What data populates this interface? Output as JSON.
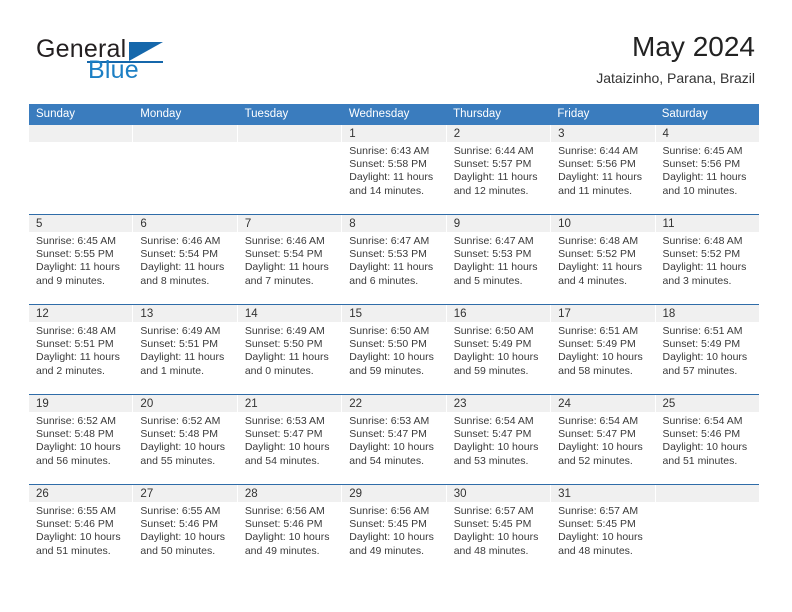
{
  "brand": {
    "name_part1": "General",
    "name_part2": "Blue",
    "flag_icon": "triangle-flag-icon"
  },
  "header": {
    "month_title": "May 2024",
    "location": "Jataizinho, Parana, Brazil"
  },
  "colors": {
    "header_band": "#3a7cbe",
    "row_divider": "#2f6ca8",
    "daynum_band": "#f0f0f0",
    "brand_blue": "#1c7fc4"
  },
  "weekdays": [
    "Sunday",
    "Monday",
    "Tuesday",
    "Wednesday",
    "Thursday",
    "Friday",
    "Saturday"
  ],
  "weeks": [
    [
      {
        "day": "",
        "empty": true
      },
      {
        "day": "",
        "empty": true
      },
      {
        "day": "",
        "empty": true
      },
      {
        "day": "1",
        "sunrise": "Sunrise: 6:43 AM",
        "sunset": "Sunset: 5:58 PM",
        "daylight1": "Daylight: 11 hours",
        "daylight2": "and 14 minutes."
      },
      {
        "day": "2",
        "sunrise": "Sunrise: 6:44 AM",
        "sunset": "Sunset: 5:57 PM",
        "daylight1": "Daylight: 11 hours",
        "daylight2": "and 12 minutes."
      },
      {
        "day": "3",
        "sunrise": "Sunrise: 6:44 AM",
        "sunset": "Sunset: 5:56 PM",
        "daylight1": "Daylight: 11 hours",
        "daylight2": "and 11 minutes."
      },
      {
        "day": "4",
        "sunrise": "Sunrise: 6:45 AM",
        "sunset": "Sunset: 5:56 PM",
        "daylight1": "Daylight: 11 hours",
        "daylight2": "and 10 minutes."
      }
    ],
    [
      {
        "day": "5",
        "sunrise": "Sunrise: 6:45 AM",
        "sunset": "Sunset: 5:55 PM",
        "daylight1": "Daylight: 11 hours",
        "daylight2": "and 9 minutes."
      },
      {
        "day": "6",
        "sunrise": "Sunrise: 6:46 AM",
        "sunset": "Sunset: 5:54 PM",
        "daylight1": "Daylight: 11 hours",
        "daylight2": "and 8 minutes."
      },
      {
        "day": "7",
        "sunrise": "Sunrise: 6:46 AM",
        "sunset": "Sunset: 5:54 PM",
        "daylight1": "Daylight: 11 hours",
        "daylight2": "and 7 minutes."
      },
      {
        "day": "8",
        "sunrise": "Sunrise: 6:47 AM",
        "sunset": "Sunset: 5:53 PM",
        "daylight1": "Daylight: 11 hours",
        "daylight2": "and 6 minutes."
      },
      {
        "day": "9",
        "sunrise": "Sunrise: 6:47 AM",
        "sunset": "Sunset: 5:53 PM",
        "daylight1": "Daylight: 11 hours",
        "daylight2": "and 5 minutes."
      },
      {
        "day": "10",
        "sunrise": "Sunrise: 6:48 AM",
        "sunset": "Sunset: 5:52 PM",
        "daylight1": "Daylight: 11 hours",
        "daylight2": "and 4 minutes."
      },
      {
        "day": "11",
        "sunrise": "Sunrise: 6:48 AM",
        "sunset": "Sunset: 5:52 PM",
        "daylight1": "Daylight: 11 hours",
        "daylight2": "and 3 minutes."
      }
    ],
    [
      {
        "day": "12",
        "sunrise": "Sunrise: 6:48 AM",
        "sunset": "Sunset: 5:51 PM",
        "daylight1": "Daylight: 11 hours",
        "daylight2": "and 2 minutes."
      },
      {
        "day": "13",
        "sunrise": "Sunrise: 6:49 AM",
        "sunset": "Sunset: 5:51 PM",
        "daylight1": "Daylight: 11 hours",
        "daylight2": "and 1 minute."
      },
      {
        "day": "14",
        "sunrise": "Sunrise: 6:49 AM",
        "sunset": "Sunset: 5:50 PM",
        "daylight1": "Daylight: 11 hours",
        "daylight2": "and 0 minutes."
      },
      {
        "day": "15",
        "sunrise": "Sunrise: 6:50 AM",
        "sunset": "Sunset: 5:50 PM",
        "daylight1": "Daylight: 10 hours",
        "daylight2": "and 59 minutes."
      },
      {
        "day": "16",
        "sunrise": "Sunrise: 6:50 AM",
        "sunset": "Sunset: 5:49 PM",
        "daylight1": "Daylight: 10 hours",
        "daylight2": "and 59 minutes."
      },
      {
        "day": "17",
        "sunrise": "Sunrise: 6:51 AM",
        "sunset": "Sunset: 5:49 PM",
        "daylight1": "Daylight: 10 hours",
        "daylight2": "and 58 minutes."
      },
      {
        "day": "18",
        "sunrise": "Sunrise: 6:51 AM",
        "sunset": "Sunset: 5:49 PM",
        "daylight1": "Daylight: 10 hours",
        "daylight2": "and 57 minutes."
      }
    ],
    [
      {
        "day": "19",
        "sunrise": "Sunrise: 6:52 AM",
        "sunset": "Sunset: 5:48 PM",
        "daylight1": "Daylight: 10 hours",
        "daylight2": "and 56 minutes."
      },
      {
        "day": "20",
        "sunrise": "Sunrise: 6:52 AM",
        "sunset": "Sunset: 5:48 PM",
        "daylight1": "Daylight: 10 hours",
        "daylight2": "and 55 minutes."
      },
      {
        "day": "21",
        "sunrise": "Sunrise: 6:53 AM",
        "sunset": "Sunset: 5:47 PM",
        "daylight1": "Daylight: 10 hours",
        "daylight2": "and 54 minutes."
      },
      {
        "day": "22",
        "sunrise": "Sunrise: 6:53 AM",
        "sunset": "Sunset: 5:47 PM",
        "daylight1": "Daylight: 10 hours",
        "daylight2": "and 54 minutes."
      },
      {
        "day": "23",
        "sunrise": "Sunrise: 6:54 AM",
        "sunset": "Sunset: 5:47 PM",
        "daylight1": "Daylight: 10 hours",
        "daylight2": "and 53 minutes."
      },
      {
        "day": "24",
        "sunrise": "Sunrise: 6:54 AM",
        "sunset": "Sunset: 5:47 PM",
        "daylight1": "Daylight: 10 hours",
        "daylight2": "and 52 minutes."
      },
      {
        "day": "25",
        "sunrise": "Sunrise: 6:54 AM",
        "sunset": "Sunset: 5:46 PM",
        "daylight1": "Daylight: 10 hours",
        "daylight2": "and 51 minutes."
      }
    ],
    [
      {
        "day": "26",
        "sunrise": "Sunrise: 6:55 AM",
        "sunset": "Sunset: 5:46 PM",
        "daylight1": "Daylight: 10 hours",
        "daylight2": "and 51 minutes."
      },
      {
        "day": "27",
        "sunrise": "Sunrise: 6:55 AM",
        "sunset": "Sunset: 5:46 PM",
        "daylight1": "Daylight: 10 hours",
        "daylight2": "and 50 minutes."
      },
      {
        "day": "28",
        "sunrise": "Sunrise: 6:56 AM",
        "sunset": "Sunset: 5:46 PM",
        "daylight1": "Daylight: 10 hours",
        "daylight2": "and 49 minutes."
      },
      {
        "day": "29",
        "sunrise": "Sunrise: 6:56 AM",
        "sunset": "Sunset: 5:45 PM",
        "daylight1": "Daylight: 10 hours",
        "daylight2": "and 49 minutes."
      },
      {
        "day": "30",
        "sunrise": "Sunrise: 6:57 AM",
        "sunset": "Sunset: 5:45 PM",
        "daylight1": "Daylight: 10 hours",
        "daylight2": "and 48 minutes."
      },
      {
        "day": "31",
        "sunrise": "Sunrise: 6:57 AM",
        "sunset": "Sunset: 5:45 PM",
        "daylight1": "Daylight: 10 hours",
        "daylight2": "and 48 minutes."
      },
      {
        "day": "",
        "empty": true
      }
    ]
  ]
}
